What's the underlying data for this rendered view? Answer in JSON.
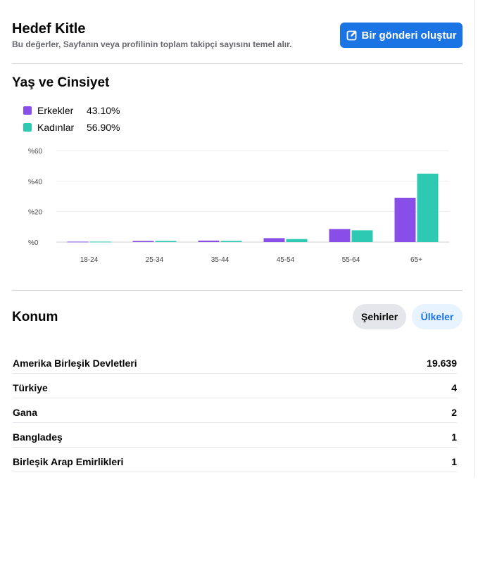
{
  "header": {
    "title": "Hedef Kitle",
    "subtitle": "Bu değerler, Sayfanın veya profilinin toplam takipçi sayısını temel alır.",
    "create_button": "Bir gönderi oluştur"
  },
  "age_gender": {
    "title": "Yaş ve Cinsiyet",
    "legend": [
      {
        "label": "Erkekler",
        "value": "43.10%",
        "color": "#8a4ee8"
      },
      {
        "label": "Kadınlar",
        "value": "56.90%",
        "color": "#2ec9b3"
      }
    ]
  },
  "chart_data": {
    "type": "bar",
    "categories": [
      "18-24",
      "25-34",
      "35-44",
      "45-54",
      "55-64",
      "65+"
    ],
    "series": [
      {
        "name": "Erkekler",
        "values": [
          0.3,
          0.8,
          1.0,
          2.6,
          8.6,
          29.1
        ]
      },
      {
        "name": "Kadınlar",
        "values": [
          0.3,
          0.8,
          0.8,
          2.0,
          7.7,
          44.9
        ]
      }
    ],
    "yticks": [
      "%0",
      "%20",
      "%40",
      "%60"
    ],
    "ylim": [
      0,
      60
    ],
    "grid": true
  },
  "location": {
    "title": "Konum",
    "cities_button": "Şehirler",
    "countries_button": "Ülkeler",
    "rows": [
      {
        "name": "Amerika Birleşik Devletleri",
        "value": "19.639"
      },
      {
        "name": "Türkiye",
        "value": "4"
      },
      {
        "name": "Gana",
        "value": "2"
      },
      {
        "name": "Bangladeş",
        "value": "1"
      },
      {
        "name": "Birleşik Arap Emirlikleri",
        "value": "1"
      }
    ]
  }
}
